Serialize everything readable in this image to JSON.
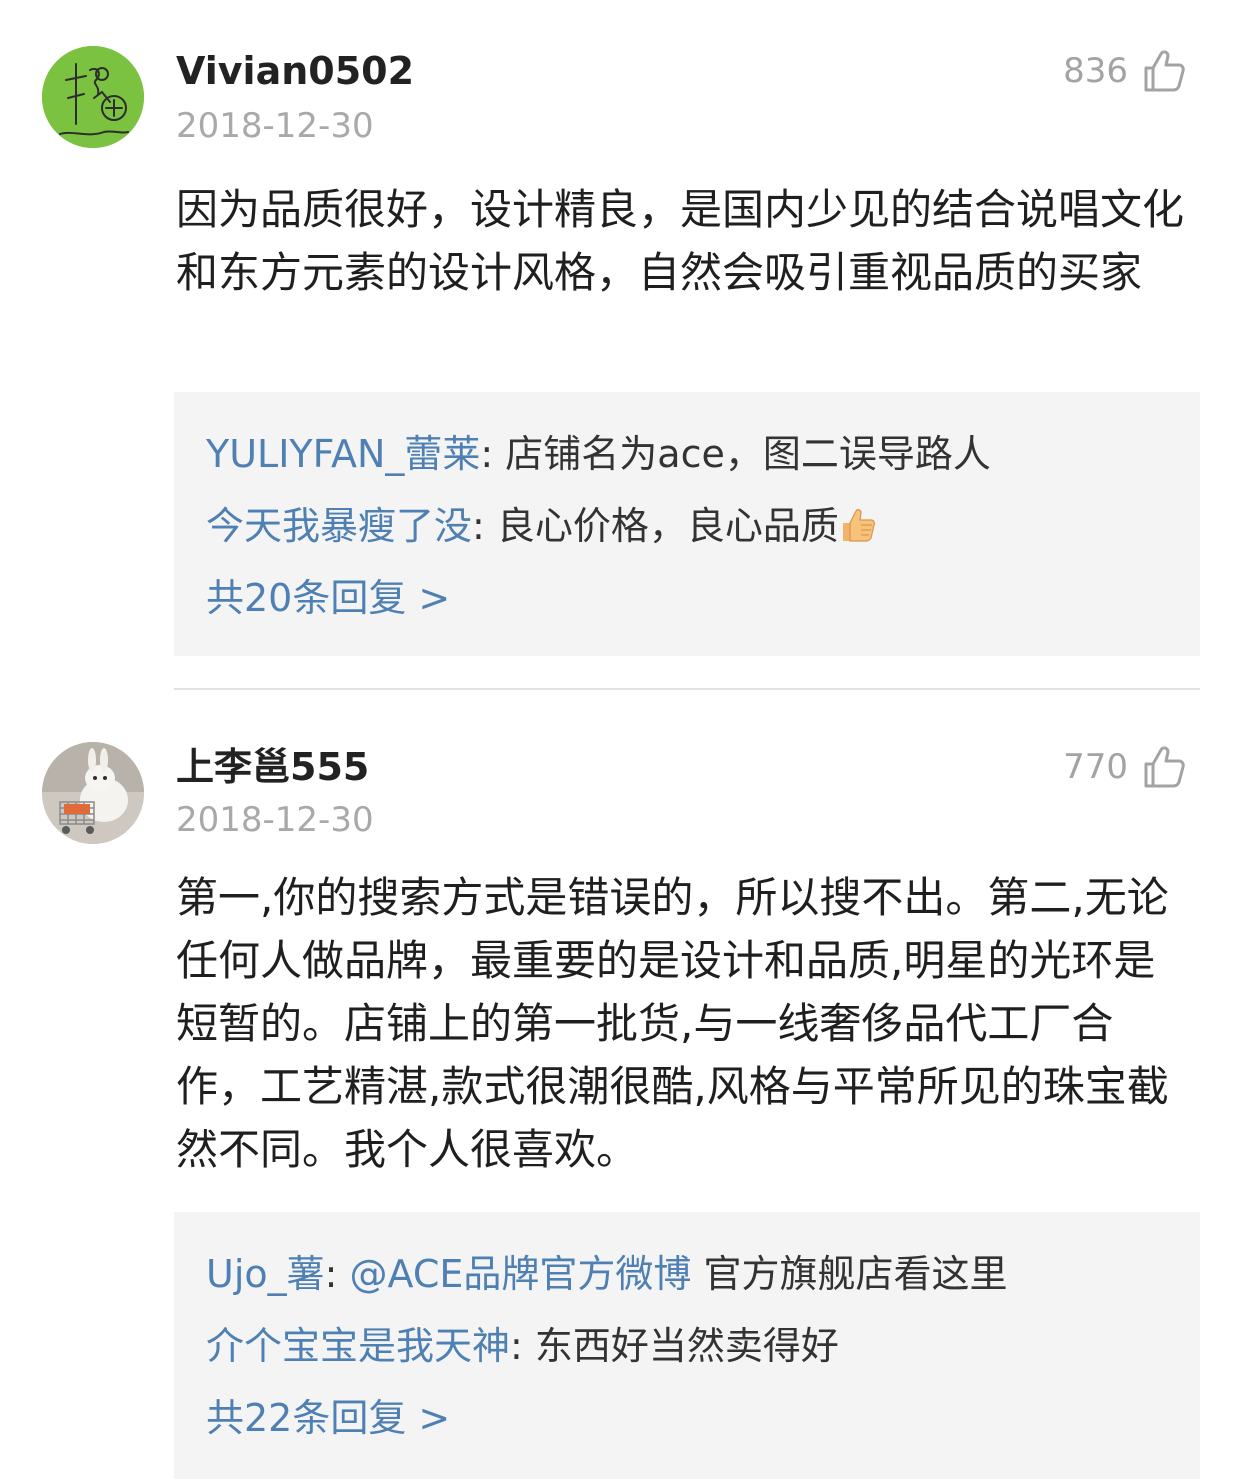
{
  "colors": {
    "link": "#4f80b3",
    "text": "#1f1f1f",
    "muted": "#a9a9a9",
    "reply_bg": "#f4f4f5",
    "avatar1_bg": "#7cc241"
  },
  "comments": [
    {
      "username": "Vivian0502",
      "date": "2018-12-30",
      "likes": "836",
      "like_icon": "thumbs-up-outline-icon",
      "text": "因为品质很好，设计精良，是国内少见的结合说唱文化和东方元素的设计风格，自然会吸引重视品质的买家",
      "replies": [
        {
          "user": "YULIYFAN_蕾莱",
          "sep": ": ",
          "text": "店铺名为ace，图二误导路人"
        },
        {
          "user": "今天我暴瘦了没",
          "sep": ": ",
          "text": "良心价格，良心品质",
          "emoji": "thumbs-up-emoji"
        }
      ],
      "more_replies": "共20条回复 >"
    },
    {
      "username": "上李邕555",
      "date": "2018-12-30",
      "likes": "770",
      "like_icon": "thumbs-up-outline-icon",
      "text": "第一,你的搜索方式是错误的，所以搜不出。第二,无论任何人做品牌，最重要的是设计和品质,明星的光环是短暂的。店铺上的第一批货,与一线奢侈品代工厂合作，工艺精湛,款式很潮很酷,风格与平常所见的珠宝截然不同。我个人很喜欢。",
      "replies": [
        {
          "user": "Ujo_薯",
          "sep": ": ",
          "mention": "@ACE品牌官方微博",
          "text": " 官方旗舰店看这里"
        },
        {
          "user": "介个宝宝是我天神",
          "sep": ": ",
          "text": "东西好当然卖得好"
        }
      ],
      "more_replies": "共22条回复 >"
    }
  ]
}
